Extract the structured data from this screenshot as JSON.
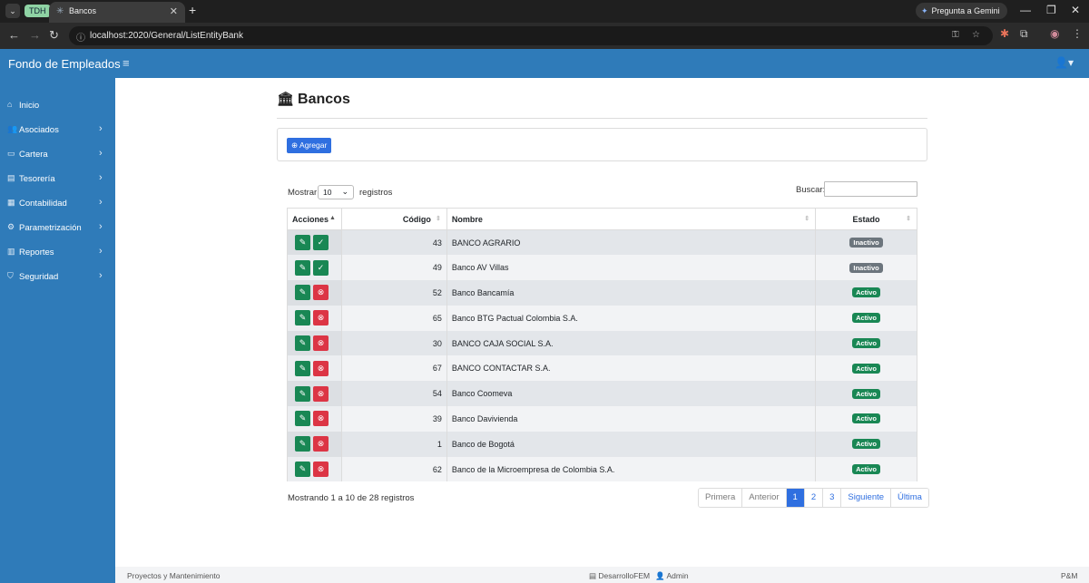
{
  "browser": {
    "tab_group": "TDH",
    "tab_title": "Bancos",
    "gemini_label": "Pregunta a Gemini",
    "url": "localhost:2020/General/ListEntityBank"
  },
  "app": {
    "brand": "Fondo de Empleados"
  },
  "sidebar": {
    "items": [
      {
        "label": "Inicio",
        "icon": "home-icon",
        "glyph": "⌂",
        "chevron": false
      },
      {
        "label": "Asociados",
        "icon": "users-icon",
        "glyph": "👥",
        "chevron": true
      },
      {
        "label": "Cartera",
        "icon": "wallet-icon",
        "glyph": "▭",
        "chevron": true
      },
      {
        "label": "Tesorería",
        "icon": "cash-icon",
        "glyph": "▤",
        "chevron": true
      },
      {
        "label": "Contabilidad",
        "icon": "ledger-icon",
        "glyph": "▦",
        "chevron": true
      },
      {
        "label": "Parametrización",
        "icon": "gear-icon",
        "glyph": "⚙",
        "chevron": true
      },
      {
        "label": "Reportes",
        "icon": "report-icon",
        "glyph": "▥",
        "chevron": true
      },
      {
        "label": "Seguridad",
        "icon": "shield-icon",
        "glyph": "⛉",
        "chevron": true
      }
    ]
  },
  "page": {
    "title": "Bancos",
    "add_button": "Agregar",
    "length_label": "Mostrar",
    "length_value": "10",
    "length_suffix": "registros",
    "search_label": "Buscar:",
    "search_value": ""
  },
  "table": {
    "columns": [
      "Acciones",
      "Código",
      "Nombre",
      "Estado"
    ],
    "rows": [
      {
        "code": "43",
        "name": "BANCO AGRARIO",
        "status": "Inactivo",
        "active": false
      },
      {
        "code": "49",
        "name": "Banco AV Villas",
        "status": "Inactivo",
        "active": false
      },
      {
        "code": "52",
        "name": "Banco Bancamía",
        "status": "Activo",
        "active": true
      },
      {
        "code": "65",
        "name": "Banco BTG Pactual Colombia S.A.",
        "status": "Activo",
        "active": true
      },
      {
        "code": "30",
        "name": "BANCO CAJA SOCIAL S.A.",
        "status": "Activo",
        "active": true
      },
      {
        "code": "67",
        "name": "BANCO CONTACTAR S.A.",
        "status": "Activo",
        "active": true
      },
      {
        "code": "54",
        "name": "Banco Coomeva",
        "status": "Activo",
        "active": true
      },
      {
        "code": "39",
        "name": "Banco Davivienda",
        "status": "Activo",
        "active": true
      },
      {
        "code": "1",
        "name": "Banco de Bogotá",
        "status": "Activo",
        "active": true
      },
      {
        "code": "62",
        "name": "Banco de la Microempresa de Colombia S.A.",
        "status": "Activo",
        "active": true
      }
    ]
  },
  "pagination": {
    "info": "Mostrando 1 a 10 de 28 registros",
    "first": "Primera",
    "prev": "Anterior",
    "pages": [
      "1",
      "2",
      "3"
    ],
    "current": "1",
    "next": "Siguiente",
    "last": "Última"
  },
  "footer": {
    "left": "Proyectos y Mantenimiento",
    "env": "DesarrolloFEM",
    "user": "Admin",
    "right": "P&M"
  },
  "colors": {
    "navbar": "#2f7bb9",
    "primary": "#2f6fe0",
    "success": "#198754",
    "danger": "#dc3545",
    "secondary": "#6c757d"
  }
}
